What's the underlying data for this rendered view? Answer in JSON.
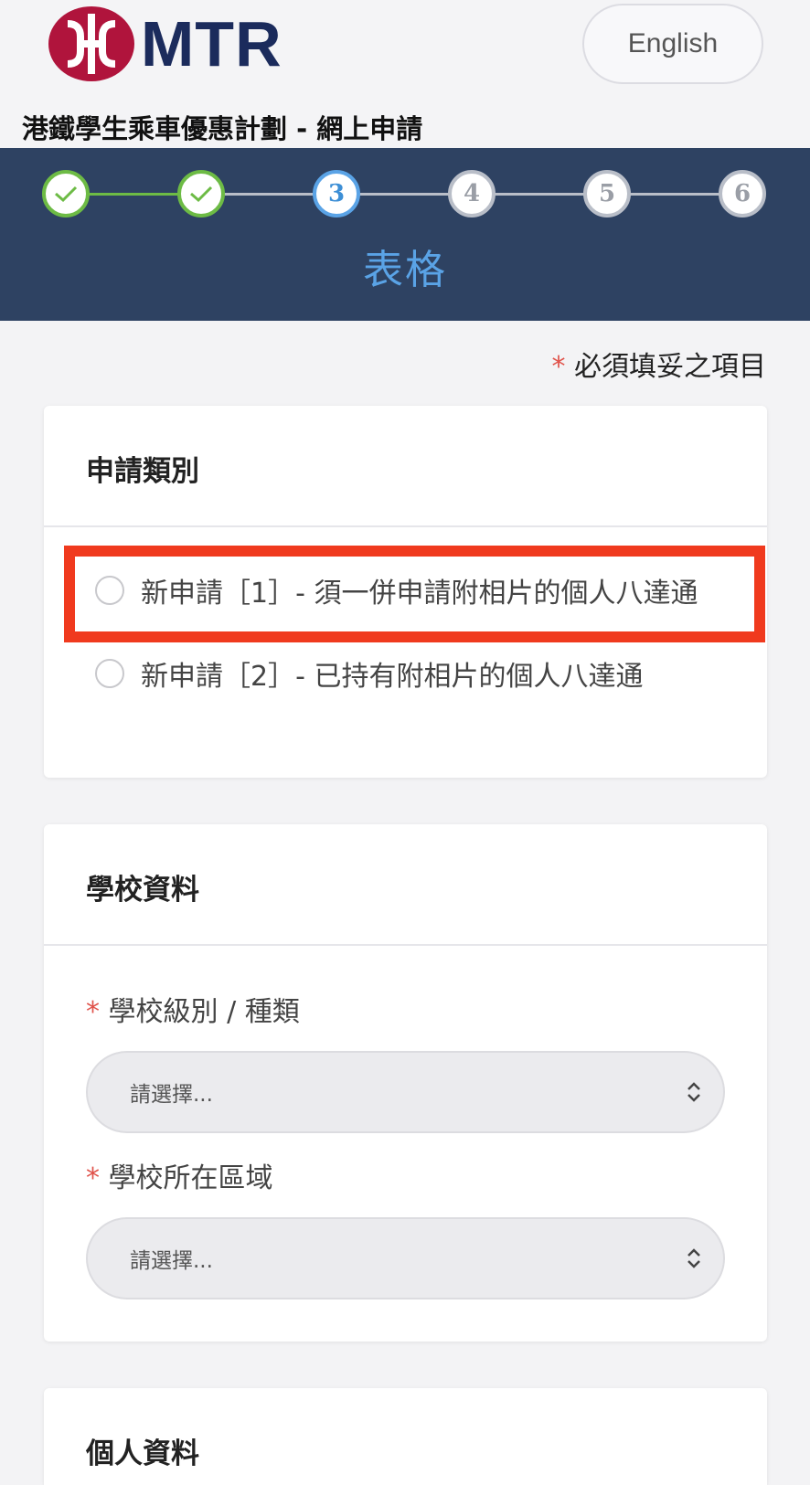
{
  "header": {
    "logo_text": "MTR",
    "language_button": "English",
    "page_title": "港鐵學生乘車優惠計劃 - 網上申請"
  },
  "stepper": {
    "steps": [
      {
        "label": "",
        "state": "done"
      },
      {
        "label": "",
        "state": "done"
      },
      {
        "label": "3",
        "state": "current"
      },
      {
        "label": "4",
        "state": "upcoming"
      },
      {
        "label": "5",
        "state": "upcoming"
      },
      {
        "label": "6",
        "state": "upcoming"
      }
    ],
    "current_title": "表格",
    "colors": {
      "done": "#6dbb45",
      "current": "#5aa3e6",
      "upcoming": "#b9bec8",
      "bar_bg": "#2e4262"
    }
  },
  "form": {
    "required_star": "*",
    "required_note": "必須填妥之項目",
    "application_type": {
      "title": "申請類別",
      "options": [
        {
          "label": "新申請［1］- 須一併申請附相片的個人八達通",
          "selected": false,
          "highlighted": true
        },
        {
          "label": "新申請［2］- 已持有附相片的個人八達通",
          "selected": false,
          "highlighted": false
        }
      ]
    },
    "school_info": {
      "title": "學校資料",
      "fields": [
        {
          "label": "學校級別 / 種類",
          "required": true,
          "value": "請選擇..."
        },
        {
          "label": "學校所在區域",
          "required": true,
          "value": "請選擇..."
        }
      ]
    },
    "personal_info": {
      "title": "個人資料"
    }
  },
  "accent_colors": {
    "brand_red": "#b0143c",
    "brand_navy": "#1b2b5c",
    "highlight": "#f03a1e",
    "required": "#e0524a"
  }
}
